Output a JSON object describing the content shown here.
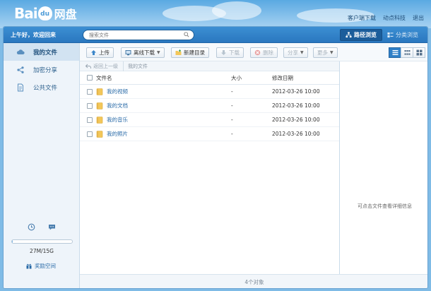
{
  "logo": {
    "brand": "Bai",
    "paw": "du",
    "product": "网盘"
  },
  "top_links": [
    "客户端下载",
    "动点科技",
    "退出"
  ],
  "header": {
    "greeting": "上午好，欢迎回来",
    "search": {
      "placeholder": "搜索文件"
    },
    "views": {
      "path_view": "路径浏览",
      "category_view": "分类浏览"
    }
  },
  "sidebar": {
    "items": [
      {
        "label": "我的文件",
        "icon": "cloud-icon",
        "active": true
      },
      {
        "label": "加密分享",
        "icon": "share-icon",
        "active": false
      },
      {
        "label": "公共文件",
        "icon": "document-icon",
        "active": false
      }
    ],
    "quota": {
      "text": "27M/15G",
      "used_fraction": 0.002
    },
    "reward": "奖励空间"
  },
  "toolbar": {
    "upload": "上传",
    "offline_download": "离线下载",
    "new_folder": "新建目录",
    "download": "下载",
    "delete": "删除",
    "share": "分享",
    "more": "更多"
  },
  "breadcrumb": {
    "back": "返回上一级",
    "current": "我的文件"
  },
  "file_list": {
    "columns": {
      "name": "文件名",
      "size": "大小",
      "date": "修改日期"
    },
    "rows": [
      {
        "name": "我的视频",
        "size": "-",
        "date": "2012-03-26 10:00"
      },
      {
        "name": "我的文档",
        "size": "-",
        "date": "2012-03-26 10:00"
      },
      {
        "name": "我的音乐",
        "size": "-",
        "date": "2012-03-26 10:00"
      },
      {
        "name": "我的照片",
        "size": "-",
        "date": "2012-03-26 10:00"
      }
    ]
  },
  "detail_panel": {
    "hint": "可点击文件查看详细信息"
  },
  "status": {
    "count": "4个对象"
  },
  "colors": {
    "accent": "#2f7fc7",
    "link": "#2a6ba8",
    "folder": "#f3c75a"
  }
}
